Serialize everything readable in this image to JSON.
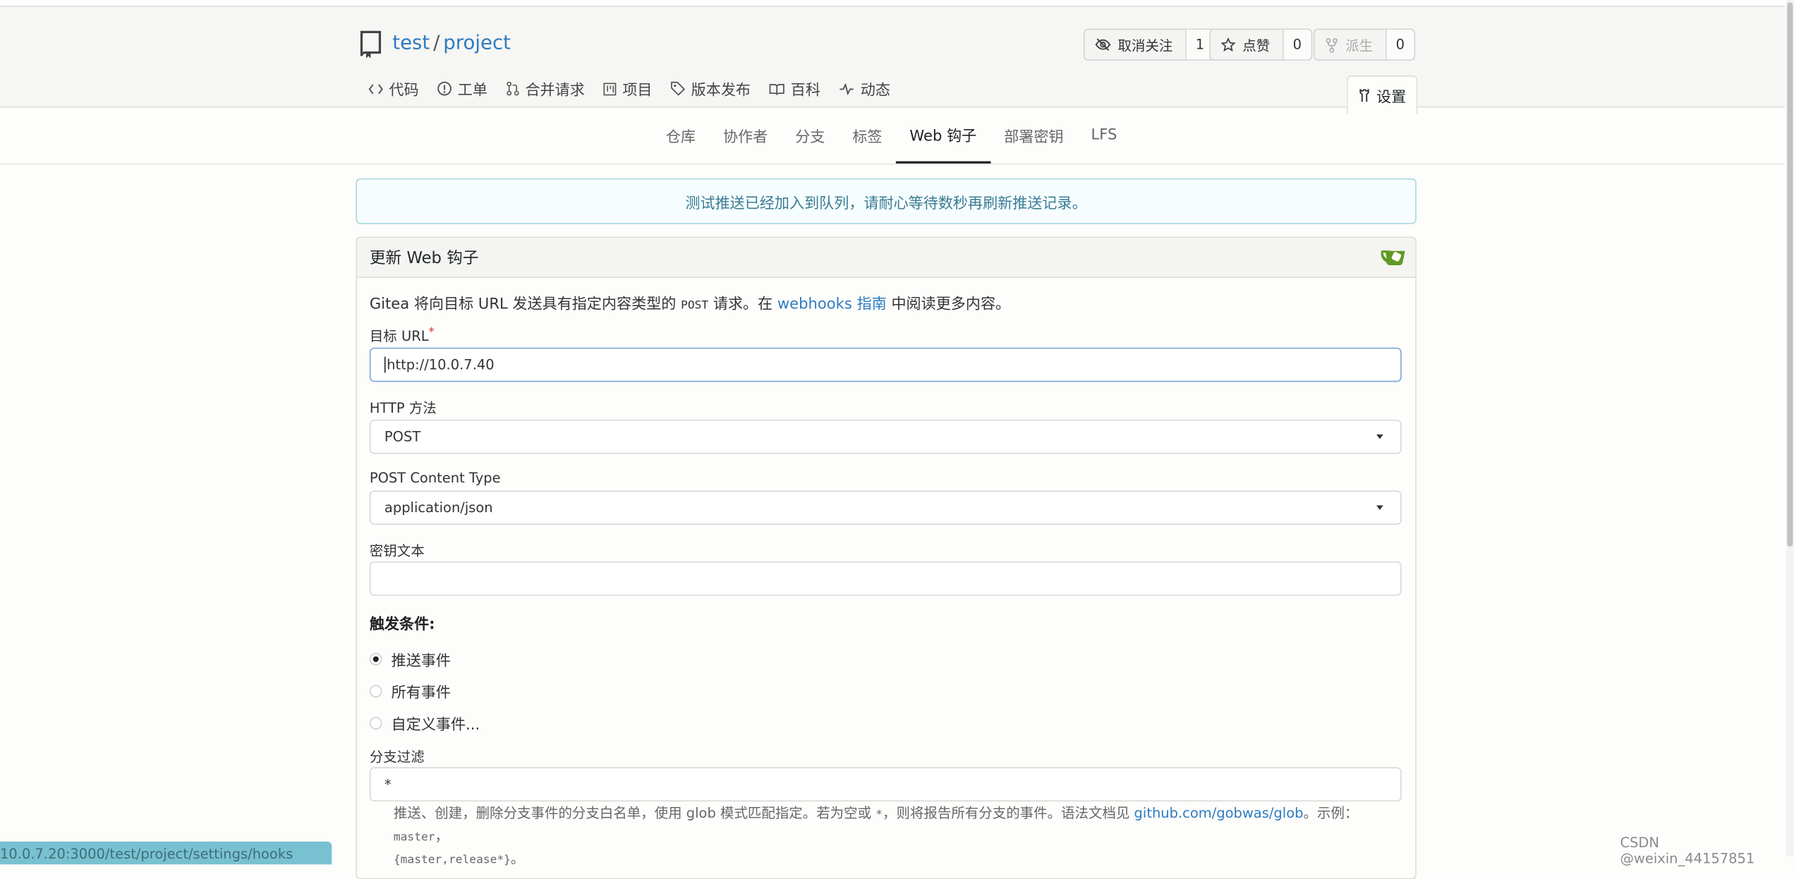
{
  "repo": {
    "owner": "test",
    "separator": "/",
    "name": "project"
  },
  "actions": [
    {
      "label": "取消关注",
      "count": "1"
    },
    {
      "label": "点赞",
      "count": "0"
    },
    {
      "label": "派生",
      "count": "0"
    }
  ],
  "nav": {
    "code": "代码",
    "issues": "工单",
    "pulls": "合并请求",
    "projects": "项目",
    "releases": "版本发布",
    "wiki": "百科",
    "activity": "动态",
    "settings": "设置"
  },
  "subnav": {
    "repository": "仓库",
    "collaborators": "协作者",
    "branches": "分支",
    "tags": "标签",
    "webhooks": "Web 钩子",
    "deploy_keys": "部署密钥",
    "lfs": "LFS"
  },
  "notice": "测试推送已经加入到队列，请耐心等待数秒再刷新推送记录。",
  "form": {
    "title": "更新 Web 钩子",
    "desc_prefix": "Gitea 将向目标 URL 发送具有指定内容类型的 ",
    "desc_code": "POST",
    "desc_mid": " 请求。在 ",
    "desc_link": "webhooks 指南",
    "desc_suffix": " 中阅读更多内容。",
    "target_url_label": "目标 URL",
    "required_mark": "*",
    "target_url_value": "http://10.0.7.40",
    "http_method_label": "HTTP 方法",
    "http_method_value": "POST",
    "content_type_label": "POST Content Type",
    "content_type_value": "application/json",
    "secret_label": "密钥文本",
    "secret_value": "",
    "trigger_title": "触发条件:",
    "triggers": [
      {
        "label": "推送事件",
        "checked": true
      },
      {
        "label": "所有事件",
        "checked": false
      },
      {
        "label": "自定义事件...",
        "checked": false
      }
    ],
    "branch_filter_label": "分支过滤",
    "branch_filter_value": "*",
    "help_1": "推送、创建，删除分支事件的分支白名单，使用 glob 模式匹配指定。若为空或 ",
    "help_code_1": "*",
    "help_2": "，则将报告所有分支的事件。语法文档见 ",
    "help_link": "github.com/gobwas/glob",
    "help_3": "。示例：",
    "help_code_2": "master",
    "help_4": "，",
    "help_code_3": "{master,release*}",
    "help_5": "。"
  },
  "statusbar": "10.0.7.20:3000/test/project/settings/hooks",
  "watermark": "CSDN @weixin_44157851",
  "colors": {
    "link": "#2f7bc0",
    "notice_text": "#3a7c94",
    "gitea_green": "#609926"
  }
}
